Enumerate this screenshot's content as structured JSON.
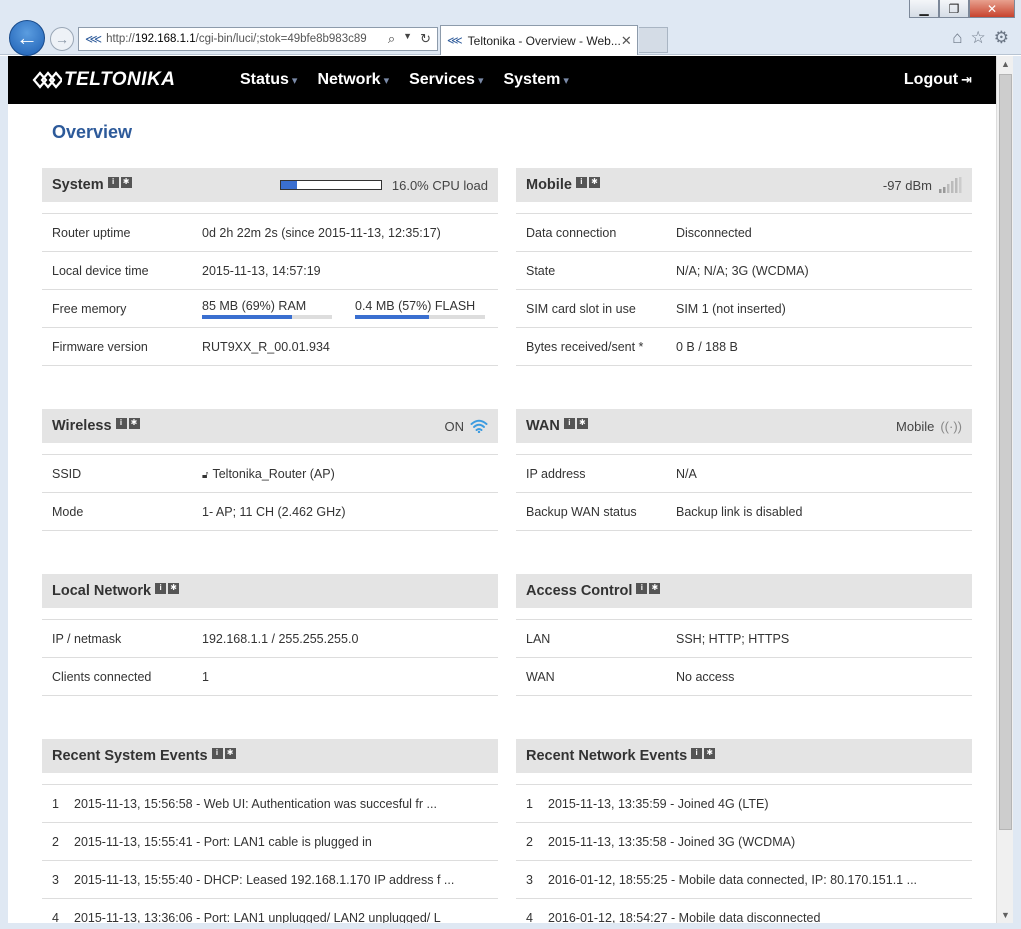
{
  "browser": {
    "url_prefix": "http://",
    "url_host": "192.168.1.1",
    "url_path": "/cgi-bin/luci/;stok=49bfe8b983c89",
    "tab_title": "Teltonika - Overview - Web...",
    "tab_close": "✕"
  },
  "nav": {
    "logo_text": "TELTONIKA",
    "menu": [
      {
        "label": "Status"
      },
      {
        "label": "Network"
      },
      {
        "label": "Services"
      },
      {
        "label": "System"
      }
    ],
    "logout": "Logout"
  },
  "page_title": "Overview",
  "system": {
    "title": "System",
    "cpu_load_pct": 16,
    "cpu_label": "16.0% CPU load",
    "rows": [
      {
        "key": "Router uptime",
        "value": "0d 2h 22m 2s (since 2015-11-13, 12:35:17)"
      },
      {
        "key": "Local device time",
        "value": "2015-11-13, 14:57:19"
      },
      {
        "key": "Free memory"
      },
      {
        "key": "Firmware version",
        "value": "RUT9XX_R_00.01.934"
      }
    ],
    "ram_label": "85 MB (69%) RAM",
    "ram_pct": 69,
    "flash_label": "0.4 MB (57%) FLASH",
    "flash_pct": 57
  },
  "mobile": {
    "title": "Mobile",
    "signal": "-97 dBm",
    "rows": [
      {
        "key": "Data connection",
        "value": "Disconnected"
      },
      {
        "key": "State",
        "value": "N/A; N/A; 3G (WCDMA)"
      },
      {
        "key": "SIM card slot in use",
        "value": "SIM 1 (not inserted)"
      },
      {
        "key": "Bytes received/sent *",
        "value": "0 B / 188 B"
      }
    ]
  },
  "wireless": {
    "title": "Wireless",
    "status": "ON",
    "rows": [
      {
        "key": "SSID",
        "value": "Teltonika_Router (AP)"
      },
      {
        "key": "Mode",
        "value": "1- AP; 11 CH (2.462 GHz)"
      }
    ]
  },
  "wan": {
    "title": "WAN",
    "status": "Mobile",
    "rows": [
      {
        "key": "IP address",
        "value": "N/A"
      },
      {
        "key": "Backup WAN status",
        "value": "Backup link is disabled"
      }
    ]
  },
  "local_network": {
    "title": "Local Network",
    "rows": [
      {
        "key": "IP / netmask",
        "value": "192.168.1.1 / 255.255.255.0"
      },
      {
        "key": "Clients connected",
        "value": "1"
      }
    ]
  },
  "access_control": {
    "title": "Access Control",
    "rows": [
      {
        "key": "LAN",
        "value": "SSH; HTTP; HTTPS"
      },
      {
        "key": "WAN",
        "value": "No access"
      }
    ]
  },
  "system_events": {
    "title": "Recent System Events",
    "items": [
      {
        "n": "1",
        "text": "2015-11-13, 15:56:58 - Web UI: Authentication was succesful fr ..."
      },
      {
        "n": "2",
        "text": "2015-11-13, 15:55:41 - Port: LAN1 cable is plugged in"
      },
      {
        "n": "3",
        "text": "2015-11-13, 15:55:40 - DHCP: Leased 192.168.1.170 IP address f ..."
      },
      {
        "n": "4",
        "text": "2015-11-13, 13:36:06 - Port: LAN1 unplugged/ LAN2 unplugged/ L"
      }
    ]
  },
  "network_events": {
    "title": "Recent Network Events",
    "items": [
      {
        "n": "1",
        "text": "2015-11-13, 13:35:59 - Joined 4G (LTE)"
      },
      {
        "n": "2",
        "text": "2015-11-13, 13:35:58 - Joined 3G (WCDMA)"
      },
      {
        "n": "3",
        "text": "2016-01-12, 18:55:25 - Mobile data connected, IP: 80.170.151.1 ..."
      },
      {
        "n": "4",
        "text": "2016-01-12, 18:54:27 - Mobile data disconnected"
      }
    ]
  },
  "colors": {
    "accent": "#2d5a9a",
    "bar": "#3a6fd0",
    "nav_bg": "#000000",
    "panel_head": "#e4e4e4"
  }
}
